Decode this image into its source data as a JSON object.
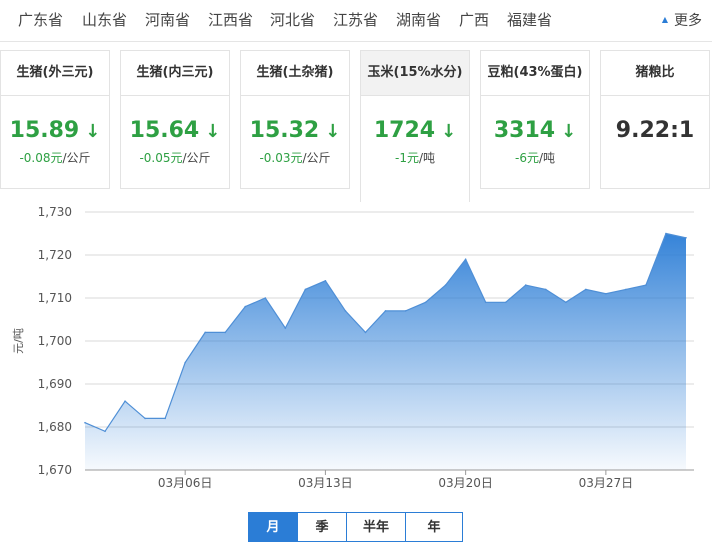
{
  "provinces": [
    "广东省",
    "山东省",
    "河南省",
    "江西省",
    "河北省",
    "江苏省",
    "湖南省",
    "广西",
    "福建省"
  ],
  "more_label": "更多",
  "cards": [
    {
      "title": "生猪(外三元)",
      "price": "15.89",
      "arrow": "↓",
      "change": "-0.08元",
      "unit": "/公斤"
    },
    {
      "title": "生猪(内三元)",
      "price": "15.64",
      "arrow": "↓",
      "change": "-0.05元",
      "unit": "/公斤"
    },
    {
      "title": "生猪(土杂猪)",
      "price": "15.32",
      "arrow": "↓",
      "change": "-0.03元",
      "unit": "/公斤"
    },
    {
      "title": "玉米(15%水分)",
      "price": "1724",
      "arrow": "↓",
      "change": "-1元",
      "unit": "/吨"
    },
    {
      "title": "豆粕(43%蛋白)",
      "price": "3314",
      "arrow": "↓",
      "change": "-6元",
      "unit": "/吨"
    },
    {
      "title": "猪粮比",
      "value": "9.22:1"
    }
  ],
  "active_card": 3,
  "periods": [
    "月",
    "季",
    "半年",
    "年"
  ],
  "active_period": 0,
  "colors": {
    "accent": "#2b7dd6",
    "down": "#2ea043"
  },
  "chart_data": {
    "type": "area",
    "ylabel": "元/吨",
    "ylim": [
      1670,
      1730
    ],
    "yticks": [
      "1,670",
      "1,680",
      "1,690",
      "1,700",
      "1,710",
      "1,720",
      "1,730"
    ],
    "x": [
      "03月01日",
      "03月02日",
      "03月03日",
      "03月04日",
      "03月05日",
      "03月06日",
      "03月07日",
      "03月08日",
      "03月09日",
      "03月10日",
      "03月11日",
      "03月12日",
      "03月13日",
      "03月14日",
      "03月15日",
      "03月16日",
      "03月17日",
      "03月18日",
      "03月19日",
      "03月20日",
      "03月21日",
      "03月22日",
      "03月23日",
      "03月24日",
      "03月25日",
      "03月26日",
      "03月27日",
      "03月28日",
      "03月29日",
      "03月30日",
      "03月31日"
    ],
    "xtick_labels": [
      "03月06日",
      "03月13日",
      "03月20日",
      "03月27日"
    ],
    "values": [
      1681,
      1679,
      1686,
      1682,
      1682,
      1695,
      1702,
      1702,
      1708,
      1710,
      1703,
      1712,
      1714,
      1707,
      1702,
      1707,
      1707,
      1709,
      1713,
      1719,
      1709,
      1709,
      1713,
      1712,
      1709,
      1712,
      1711,
      1712,
      1713,
      1725,
      1724
    ],
    "grid": true,
    "color": "#2b7dd6"
  }
}
